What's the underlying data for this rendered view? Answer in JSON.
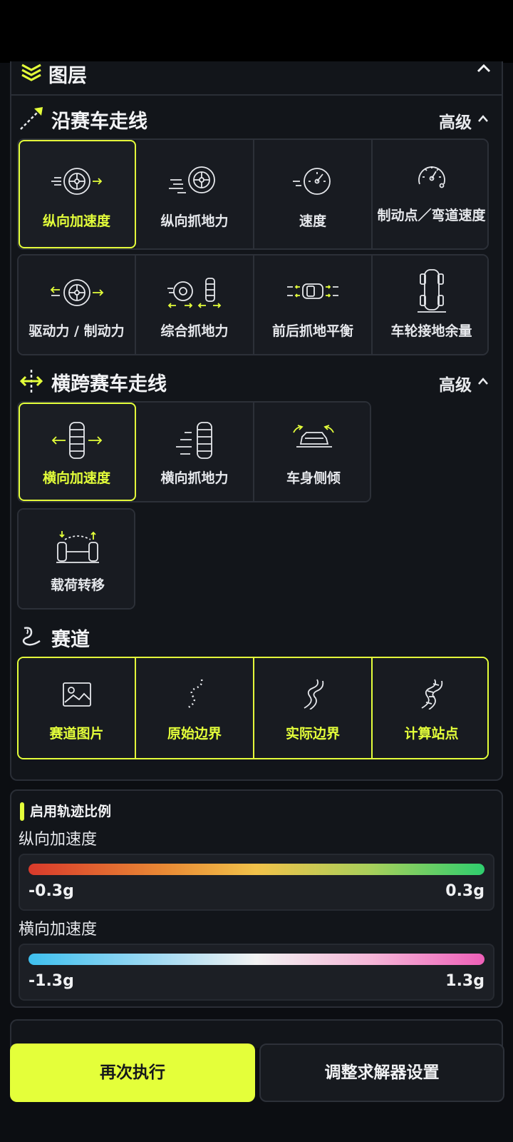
{
  "layers": {
    "title": "图层"
  },
  "along": {
    "title": "沿赛车走线",
    "advanced": "高级",
    "row1": [
      {
        "label": "纵向加速度",
        "icon": "longitudinal-acceleration-icon",
        "active": true
      },
      {
        "label": "纵向抓地力",
        "icon": "longitudinal-grip-icon",
        "active": false
      },
      {
        "label": "速度",
        "icon": "speedometer-icon",
        "active": false
      },
      {
        "label": "制动点／弯道速度",
        "icon": "brake-point-gauge-icon",
        "active": false
      }
    ],
    "row2": [
      {
        "label": "驱动力 / 制动力",
        "icon": "drive-brake-force-icon"
      },
      {
        "label": "综合抓地力",
        "icon": "combined-grip-icon"
      },
      {
        "label": "前后抓地平衡",
        "icon": "front-rear-balance-icon"
      },
      {
        "label": "车轮接地余量",
        "icon": "wheel-contact-margin-icon"
      }
    ]
  },
  "across": {
    "title": "横跨赛车走线",
    "advanced": "高级",
    "row1": [
      {
        "label": "横向加速度",
        "icon": "lateral-acceleration-icon",
        "active": true
      },
      {
        "label": "横向抓地力",
        "icon": "lateral-grip-icon",
        "active": false
      },
      {
        "label": "车身侧倾",
        "icon": "body-roll-icon",
        "active": false
      }
    ],
    "row2": [
      {
        "label": "载荷转移",
        "icon": "load-transfer-icon"
      }
    ]
  },
  "track": {
    "title": "赛道",
    "items": [
      {
        "label": "赛道图片",
        "icon": "image-icon"
      },
      {
        "label": "原始边界",
        "icon": "raw-boundary-icon"
      },
      {
        "label": "实际边界",
        "icon": "actual-boundary-icon"
      },
      {
        "label": "计算站点",
        "icon": "computed-stations-icon"
      }
    ]
  },
  "scale": {
    "title": "启用轨迹比例",
    "longitudinal": {
      "label": "纵向加速度",
      "min": "-0.3g",
      "max": "0.3g"
    },
    "lateral": {
      "label": "横向加速度",
      "min": "-1.3g",
      "max": "1.3g"
    }
  },
  "actions": {
    "rerun": "再次执行",
    "adjust": "调整求解器设置"
  },
  "colors": {
    "accent": "#e4ff3a",
    "background": "#0c0e12",
    "panel": "#12151a"
  }
}
